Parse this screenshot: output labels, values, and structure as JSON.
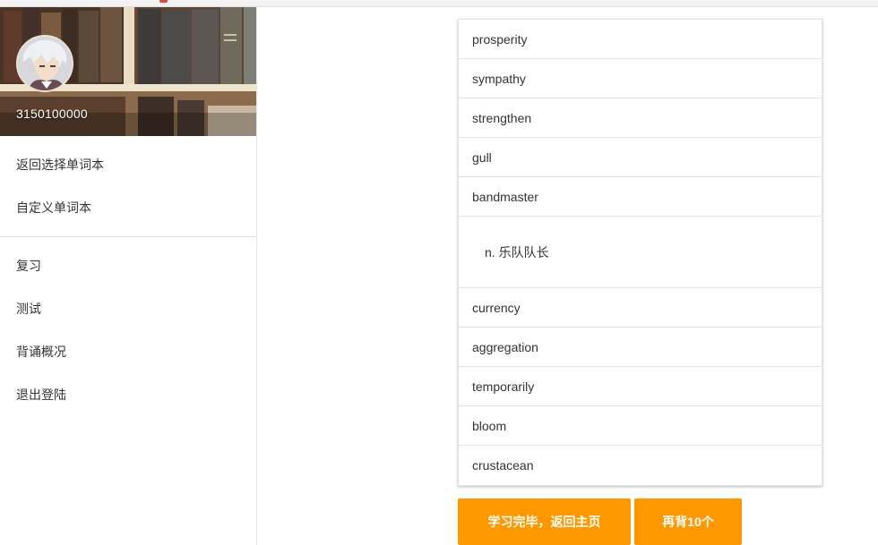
{
  "user": {
    "id": "3150100000"
  },
  "sidebar": {
    "menu1": [
      "返回选择单词本",
      "自定义单词本"
    ],
    "menu2": [
      "复习",
      "测试",
      "背诵概况",
      "退出登陆"
    ]
  },
  "words": {
    "before": [
      "prosperity",
      "sympathy",
      "strengthen",
      "gull",
      "bandmaster"
    ],
    "definition": "n. 乐队队长",
    "after": [
      "currency",
      "aggregation",
      "temporarily",
      "bloom",
      "crustacean"
    ]
  },
  "buttons": {
    "finish": "学习完毕，返回主页",
    "more": "再背10个"
  },
  "colors": {
    "accent": "#ff9800"
  }
}
